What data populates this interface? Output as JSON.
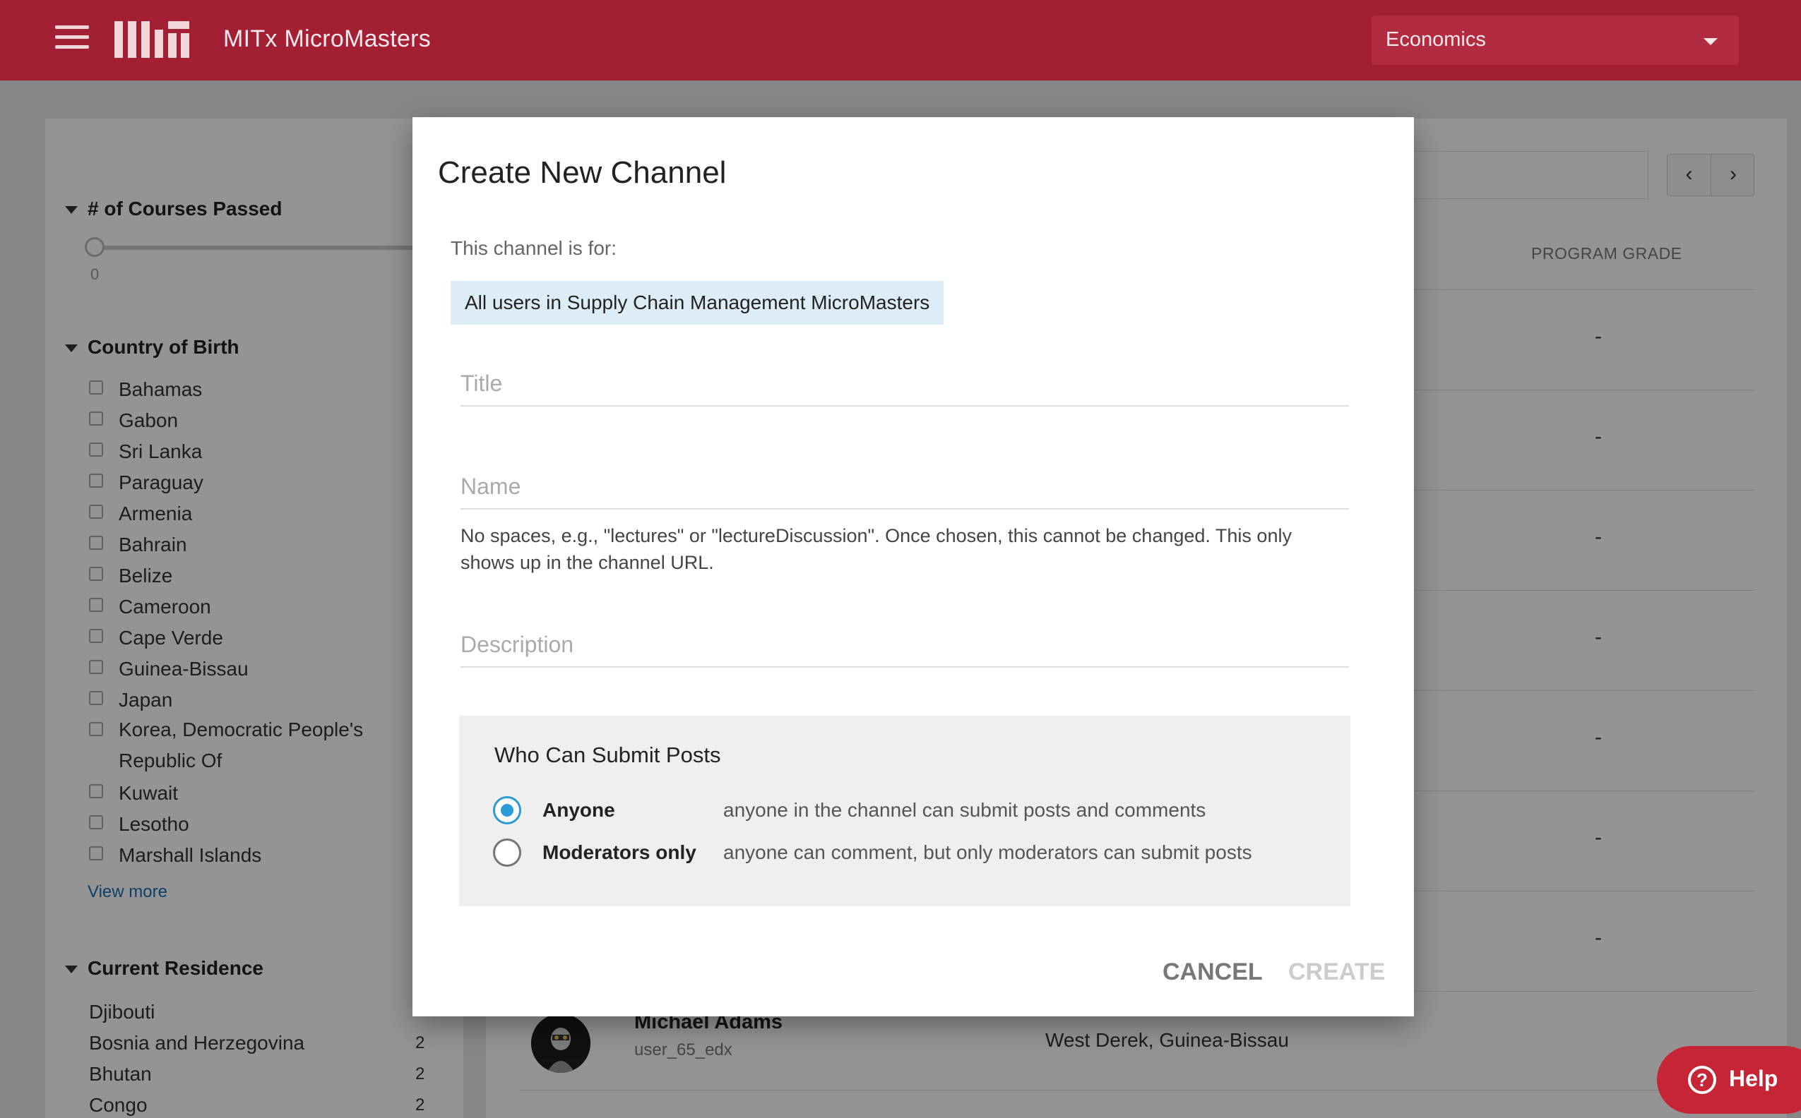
{
  "header": {
    "app_title": "MITx MicroMasters",
    "program_selected": "Economics"
  },
  "sidebar": {
    "courses_passed_title": "# of Courses Passed",
    "slider_min": "0",
    "country_of_birth_title": "Country of Birth",
    "countries": [
      "Bahamas",
      "Gabon",
      "Sri Lanka",
      "Paraguay",
      "Armenia",
      "Bahrain",
      "Belize",
      "Cameroon",
      "Cape Verde",
      "Guinea-Bissau",
      "Japan",
      "Korea, Democratic People's Republic Of",
      "Kuwait",
      "Lesotho",
      "Marshall Islands"
    ],
    "view_more": "View more",
    "current_residence_title": "Current Residence",
    "residences": [
      {
        "name": "Djibouti",
        "count": ""
      },
      {
        "name": "Bosnia and Herzegovina",
        "count": "2"
      },
      {
        "name": "Bhutan",
        "count": "2"
      },
      {
        "name": "Congo",
        "count": "2"
      }
    ]
  },
  "main": {
    "program_grade_header": "PROGRAM GRADE",
    "row_grade": "-",
    "student": {
      "name": "Michael Adams",
      "username": "user_65_edx",
      "location": "West Derek, Guinea-Bissau"
    }
  },
  "dialog": {
    "title": "Create New Channel",
    "for_label": "This channel is for:",
    "for_value": "All users in Supply Chain Management MicroMasters",
    "title_placeholder": "Title",
    "name_placeholder": "Name",
    "name_hint": "No spaces, e.g., \"lectures\" or \"lectureDiscussion\". Once chosen, this cannot be changed. This only shows up in the channel URL.",
    "description_placeholder": "Description",
    "posts_title": "Who Can Submit Posts",
    "options": [
      {
        "name": "Anyone",
        "desc": "anyone in the channel can submit posts and comments",
        "selected": true
      },
      {
        "name": "Moderators only",
        "desc": "anyone can comment, but only moderators can submit posts",
        "selected": false
      }
    ],
    "cancel_label": "CANCEL",
    "create_label": "CREATE"
  },
  "help": {
    "icon": "question-circle-icon",
    "label": "Help"
  },
  "colors": {
    "brand": "#a31f34",
    "radio_active": "#2a9bd7",
    "chip_bg": "#dcedf7"
  }
}
